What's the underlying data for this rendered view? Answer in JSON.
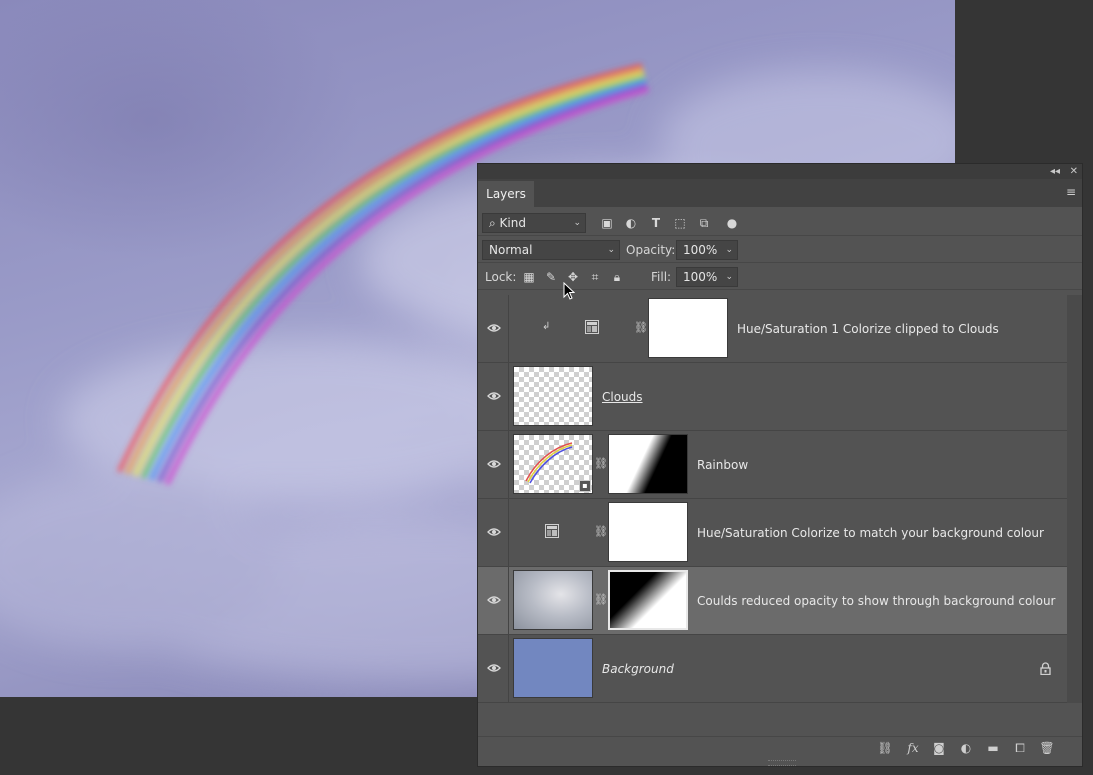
{
  "panel": {
    "tab_label": "Layers",
    "filter": {
      "label": "Kind"
    },
    "blend_mode": "Normal",
    "opacity_label": "Opacity:",
    "opacity_value": "100%",
    "lock_label": "Lock:",
    "fill_label": "Fill:",
    "fill_value": "100%"
  },
  "layers": [
    {
      "name": "Hue/Saturation 1 Colorize clipped to Clouds",
      "type": "adjustment-clipped",
      "visible": true,
      "selected": false
    },
    {
      "name": "Clouds",
      "type": "pixel",
      "visible": true,
      "selected": false
    },
    {
      "name": "Rainbow",
      "type": "smart-object",
      "visible": true,
      "selected": false
    },
    {
      "name": "Hue/Saturation Colorize to match your background colour",
      "type": "adjustment",
      "visible": true,
      "selected": false
    },
    {
      "name": "Coulds reduced opacity to show through background colour",
      "type": "pixel-masked",
      "visible": true,
      "selected": true
    },
    {
      "name": "Background",
      "type": "background",
      "visible": true,
      "selected": false,
      "locked": true
    }
  ],
  "colors": {
    "panel_bg": "#535353",
    "selected_row": "#6b6b6b",
    "background_fill": "#7287c0",
    "canvas_tint": "#9a9bc8"
  },
  "icons": {
    "filter": [
      "image-filter-icon",
      "adjustment-filter-icon",
      "type-filter-icon",
      "shape-filter-icon",
      "smart-object-filter-icon",
      "filter-toggle-icon"
    ],
    "lock": [
      "lock-transparent-pixels-icon",
      "lock-image-pixels-icon",
      "lock-position-icon",
      "lock-artboard-icon",
      "lock-all-icon"
    ],
    "footer": [
      "link-layers-icon",
      "fx-icon",
      "add-mask-icon",
      "new-adjustment-icon",
      "new-group-icon",
      "new-layer-icon",
      "delete-layer-icon"
    ]
  }
}
